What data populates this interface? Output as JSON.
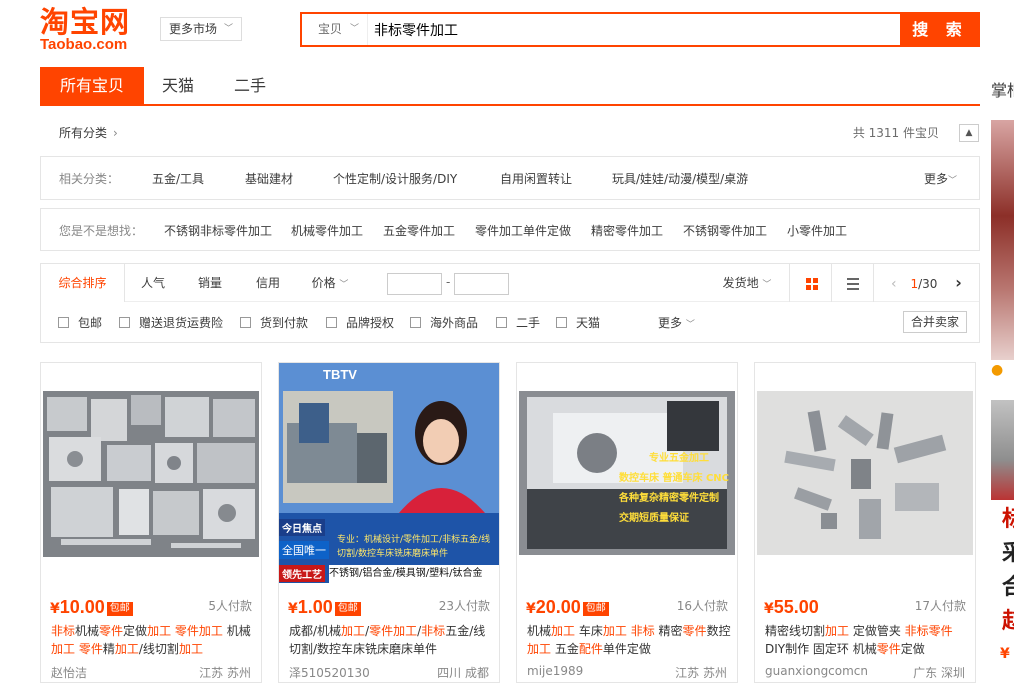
{
  "header": {
    "logo_cn": "淘宝网",
    "logo_en": "Taobao.com",
    "more_market": "更多市场",
    "search_type": "宝贝",
    "search_query": "非标零件加工",
    "search_button": "搜 索"
  },
  "tabs": [
    {
      "label": "所有宝贝",
      "active": true
    },
    {
      "label": "天猫",
      "active": false
    },
    {
      "label": "二手",
      "active": false
    }
  ],
  "side_title": "掌柜",
  "breadcrumb": "所有分类",
  "total": "共 1311 件宝贝",
  "related": {
    "label": "相关分类：",
    "items": [
      "五金/工具",
      "基础建材",
      "个性定制/设计服务/DIY",
      "自用闲置转让",
      "玩具/娃娃/动漫/模型/桌游"
    ],
    "more": "更多"
  },
  "guess": {
    "label": "您是不是想找：",
    "items": [
      "不锈钢非标零件加工",
      "机械零件加工",
      "五金零件加工",
      "零件加工单件定做",
      "精密零件加工",
      "不锈钢零件加工",
      "小零件加工"
    ]
  },
  "sort": {
    "items": [
      "综合排序",
      "人气",
      "销量",
      "信用",
      "价格"
    ],
    "ship_from": "发货地",
    "page_current": "1",
    "page_total": "/30"
  },
  "filters": {
    "checks": [
      "包邮",
      "赠送退货运费险",
      "货到付款",
      "品牌授权",
      "海外商品",
      "二手",
      "天猫"
    ],
    "more": "更多",
    "merge": "合并卖家"
  },
  "products": [
    {
      "price": "10.00",
      "free_ship": "包邮",
      "sold": "5人付款",
      "title": [
        [
          "非标",
          true
        ],
        [
          "机械",
          false
        ],
        [
          "零件",
          true
        ],
        [
          "定做",
          false
        ],
        [
          "加工",
          true
        ],
        [
          " ",
          false
        ],
        [
          "零件加工",
          true
        ],
        [
          " 机械",
          false
        ],
        [
          "加工",
          true
        ],
        [
          " ",
          false
        ],
        [
          "零件",
          true
        ],
        [
          "精",
          false
        ],
        [
          "加工",
          true
        ],
        [
          "/线切割",
          false
        ],
        [
          "加工",
          true
        ]
      ],
      "shop": "赵怡洁",
      "location": "江苏 苏州"
    },
    {
      "price": "1.00",
      "free_ship": "包邮",
      "sold": "23人付款",
      "title": [
        [
          "成都/机械",
          false
        ],
        [
          "加工",
          true
        ],
        [
          "/",
          false
        ],
        [
          "零件加工",
          true
        ],
        [
          "/",
          false
        ],
        [
          "非标",
          true
        ],
        [
          "五金/线切割/数控车床铣床磨床单件",
          false
        ]
      ],
      "shop": "泽510520130",
      "location": "四川 成都",
      "overlay": {
        "tbtv": "TBTV",
        "hot": "今日焦点",
        "unique": "全国唯一",
        "ticker": "专业：机械设计/零件加工/非标五金/线切割/数控车床铣床磨床单件",
        "craft": "领先工艺",
        "materials": "不锈钢/铝合金/模具钢/塑料/钛合金"
      }
    },
    {
      "price": "20.00",
      "free_ship": "包邮",
      "sold": "16人付款",
      "title": [
        [
          "机械",
          false
        ],
        [
          "加工",
          true
        ],
        [
          " 车床",
          false
        ],
        [
          "加工",
          true
        ],
        [
          " ",
          false
        ],
        [
          "非标",
          true
        ],
        [
          " 精密",
          false
        ],
        [
          "零件",
          true
        ],
        [
          "数控",
          false
        ],
        [
          "加工",
          true
        ],
        [
          " 五金",
          false
        ],
        [
          "配件",
          true
        ],
        [
          "单件定做",
          false
        ]
      ],
      "shop": "mije1989",
      "location": "江苏 苏州",
      "overlay": {
        "l1": "专业五金加工",
        "l2": "数控车床  普通车床  CNC",
        "l3": "各种复杂精密零件定制",
        "l4": "交期短质量保证"
      }
    },
    {
      "price": "55.00",
      "free_ship": "",
      "sold": "17人付款",
      "title": [
        [
          "精密线切割",
          false
        ],
        [
          "加工",
          true
        ],
        [
          " 定做管夹 ",
          false
        ],
        [
          "非标零件",
          true
        ],
        [
          " DIY制作 固定环 机械",
          false
        ],
        [
          "零件",
          true
        ],
        [
          "定做",
          false
        ]
      ],
      "shop": "guanxiongcomcn",
      "location": "广东 深圳"
    }
  ],
  "side_ad": {
    "text": [
      "标",
      "采",
      "合"
    ],
    "red_text": "赵",
    "yen": "¥"
  },
  "colors": {
    "accent": "#ff4400"
  }
}
